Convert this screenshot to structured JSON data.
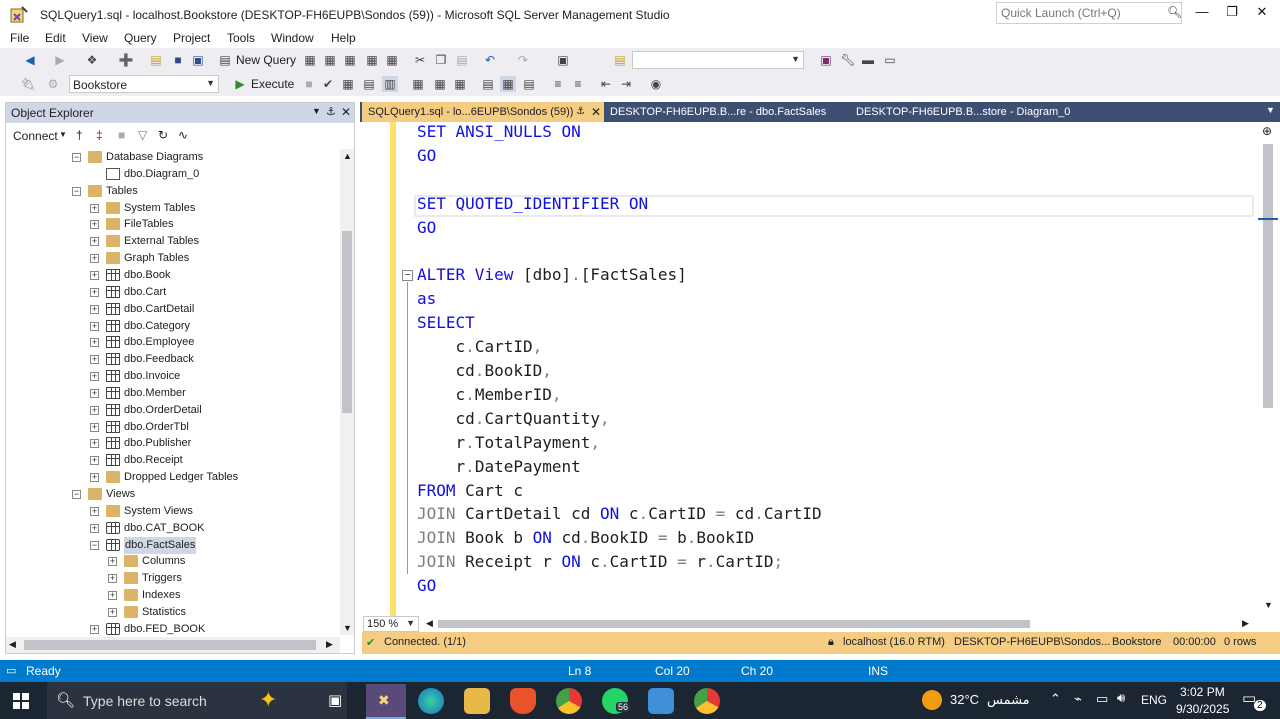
{
  "window": {
    "title": "SQLQuery1.sql - localhost.Bookstore (DESKTOP-FH6EUPB\\Sondos (59)) - Microsoft SQL Server Management Studio",
    "quick_launch_placeholder": "Quick Launch (Ctrl+Q)"
  },
  "menu": [
    "File",
    "Edit",
    "View",
    "Query",
    "Project",
    "Tools",
    "Window",
    "Help"
  ],
  "toolbar": {
    "new_query": "New Query",
    "database": "Bookstore",
    "execute": "Execute"
  },
  "object_explorer": {
    "title": "Object Explorer",
    "connect": "Connect",
    "tree": [
      {
        "label": "Database Diagrams",
        "level": 0,
        "icon": "folder",
        "expander": "minus"
      },
      {
        "label": "dbo.Diagram_0",
        "level": 1,
        "icon": "diagram",
        "expander": "none"
      },
      {
        "label": "Tables",
        "level": 0,
        "icon": "folder",
        "expander": "minus"
      },
      {
        "label": "System Tables",
        "level": 1,
        "icon": "folder",
        "expander": "plus"
      },
      {
        "label": "FileTables",
        "level": 1,
        "icon": "folder",
        "expander": "plus"
      },
      {
        "label": "External Tables",
        "level": 1,
        "icon": "folder",
        "expander": "plus"
      },
      {
        "label": "Graph Tables",
        "level": 1,
        "icon": "folder",
        "expander": "plus"
      },
      {
        "label": "dbo.Book",
        "level": 1,
        "icon": "table",
        "expander": "plus"
      },
      {
        "label": "dbo.Cart",
        "level": 1,
        "icon": "table",
        "expander": "plus"
      },
      {
        "label": "dbo.CartDetail",
        "level": 1,
        "icon": "table",
        "expander": "plus"
      },
      {
        "label": "dbo.Category",
        "level": 1,
        "icon": "table",
        "expander": "plus"
      },
      {
        "label": "dbo.Employee",
        "level": 1,
        "icon": "table",
        "expander": "plus"
      },
      {
        "label": "dbo.Feedback",
        "level": 1,
        "icon": "table",
        "expander": "plus"
      },
      {
        "label": "dbo.Invoice",
        "level": 1,
        "icon": "table",
        "expander": "plus"
      },
      {
        "label": "dbo.Member",
        "level": 1,
        "icon": "table",
        "expander": "plus"
      },
      {
        "label": "dbo.OrderDetail",
        "level": 1,
        "icon": "table",
        "expander": "plus"
      },
      {
        "label": "dbo.OrderTbl",
        "level": 1,
        "icon": "table",
        "expander": "plus"
      },
      {
        "label": "dbo.Publisher",
        "level": 1,
        "icon": "table",
        "expander": "plus"
      },
      {
        "label": "dbo.Receipt",
        "level": 1,
        "icon": "table",
        "expander": "plus"
      },
      {
        "label": "Dropped Ledger Tables",
        "level": 1,
        "icon": "folder",
        "expander": "plus"
      },
      {
        "label": "Views",
        "level": 0,
        "icon": "folder",
        "expander": "minus"
      },
      {
        "label": "System Views",
        "level": 1,
        "icon": "folder",
        "expander": "plus"
      },
      {
        "label": "dbo.CAT_BOOK",
        "level": 1,
        "icon": "view",
        "expander": "plus"
      },
      {
        "label": "dbo.FactSales",
        "level": 1,
        "icon": "view",
        "expander": "minus",
        "selected": true
      },
      {
        "label": "Columns",
        "level": 2,
        "icon": "folder",
        "expander": "plus"
      },
      {
        "label": "Triggers",
        "level": 2,
        "icon": "folder",
        "expander": "plus"
      },
      {
        "label": "Indexes",
        "level": 2,
        "icon": "folder",
        "expander": "plus"
      },
      {
        "label": "Statistics",
        "level": 2,
        "icon": "folder",
        "expander": "plus"
      },
      {
        "label": "dbo.FED_BOOK",
        "level": 1,
        "icon": "view",
        "expander": "plus"
      }
    ]
  },
  "tabs": [
    {
      "label": "SQLQuery1.sql - lo...6EUPB\\Sondos (59))",
      "active": true
    },
    {
      "label": "DESKTOP-FH6EUPB.B...re - dbo.FactSales",
      "active": false
    },
    {
      "label": "DESKTOP-FH6EUPB.B...store - Diagram_0",
      "active": false
    }
  ],
  "code_lines": [
    [
      {
        "t": "SET ANSI_NULLS ON",
        "c": "kw"
      }
    ],
    [
      {
        "t": "GO",
        "c": "kw"
      }
    ],
    [],
    [
      {
        "t": "SET QUOTED_IDENTIFIER ON",
        "c": "kw"
      }
    ],
    [
      {
        "t": "GO",
        "c": "kw"
      }
    ],
    [],
    [
      {
        "t": "ALTER View",
        "c": "kw"
      },
      {
        "t": " [dbo]",
        "c": ""
      },
      {
        "t": ".",
        "c": "gr"
      },
      {
        "t": "[FactSales]",
        "c": ""
      }
    ],
    [
      {
        "t": "as",
        "c": "kw"
      }
    ],
    [
      {
        "t": "SELECT",
        "c": "kw"
      }
    ],
    [
      {
        "t": "    c",
        "c": ""
      },
      {
        "t": ".",
        "c": "gr"
      },
      {
        "t": "CartID",
        "c": ""
      },
      {
        "t": ",",
        "c": "gr"
      }
    ],
    [
      {
        "t": "    cd",
        "c": ""
      },
      {
        "t": ".",
        "c": "gr"
      },
      {
        "t": "BookID",
        "c": ""
      },
      {
        "t": ",",
        "c": "gr"
      }
    ],
    [
      {
        "t": "    c",
        "c": ""
      },
      {
        "t": ".",
        "c": "gr"
      },
      {
        "t": "MemberID",
        "c": ""
      },
      {
        "t": ",",
        "c": "gr"
      }
    ],
    [
      {
        "t": "    cd",
        "c": ""
      },
      {
        "t": ".",
        "c": "gr"
      },
      {
        "t": "CartQuantity",
        "c": ""
      },
      {
        "t": ",",
        "c": "gr"
      }
    ],
    [
      {
        "t": "    r",
        "c": ""
      },
      {
        "t": ".",
        "c": "gr"
      },
      {
        "t": "TotalPayment",
        "c": ""
      },
      {
        "t": ",",
        "c": "gr"
      }
    ],
    [
      {
        "t": "    r",
        "c": ""
      },
      {
        "t": ".",
        "c": "gr"
      },
      {
        "t": "DatePayment",
        "c": ""
      }
    ],
    [
      {
        "t": "FROM",
        "c": "kw"
      },
      {
        "t": " Cart c",
        "c": ""
      }
    ],
    [
      {
        "t": "JOIN",
        "c": "gr"
      },
      {
        "t": " CartDetail cd ",
        "c": ""
      },
      {
        "t": "ON",
        "c": "kw"
      },
      {
        "t": " c",
        "c": ""
      },
      {
        "t": ".",
        "c": "gr"
      },
      {
        "t": "CartID ",
        "c": ""
      },
      {
        "t": "=",
        "c": "gr"
      },
      {
        "t": " cd",
        "c": ""
      },
      {
        "t": ".",
        "c": "gr"
      },
      {
        "t": "CartID",
        "c": ""
      }
    ],
    [
      {
        "t": "JOIN",
        "c": "gr"
      },
      {
        "t": " Book b ",
        "c": ""
      },
      {
        "t": "ON",
        "c": "kw"
      },
      {
        "t": " cd",
        "c": ""
      },
      {
        "t": ".",
        "c": "gr"
      },
      {
        "t": "BookID ",
        "c": ""
      },
      {
        "t": "=",
        "c": "gr"
      },
      {
        "t": " b",
        "c": ""
      },
      {
        "t": ".",
        "c": "gr"
      },
      {
        "t": "BookID",
        "c": ""
      }
    ],
    [
      {
        "t": "JOIN",
        "c": "gr"
      },
      {
        "t": " Receipt r ",
        "c": ""
      },
      {
        "t": "ON",
        "c": "kw"
      },
      {
        "t": " c",
        "c": ""
      },
      {
        "t": ".",
        "c": "gr"
      },
      {
        "t": "CartID ",
        "c": ""
      },
      {
        "t": "=",
        "c": "gr"
      },
      {
        "t": " r",
        "c": ""
      },
      {
        "t": ".",
        "c": "gr"
      },
      {
        "t": "CartID",
        "c": ""
      },
      {
        "t": ";",
        "c": "gr"
      }
    ],
    [
      {
        "t": "GO",
        "c": "kw"
      }
    ]
  ],
  "zoom": "150 %",
  "editor_status": {
    "connected": "Connected. (1/1)",
    "server": "localhost (16.0 RTM)",
    "user": "DESKTOP-FH6EUPB\\Sondos...",
    "database": "Bookstore",
    "time": "00:00:00",
    "rows": "0 rows"
  },
  "statusbar": {
    "ready": "Ready",
    "ln": "Ln 8",
    "col": "Col 20",
    "ch": "Ch 20",
    "ins": "INS"
  },
  "taskbar": {
    "search_placeholder": "Type here to search",
    "weather": "32°C",
    "weather_desc": "مشمس",
    "lang": "ENG",
    "time": "3:02 PM",
    "date": "9/30/2025",
    "badge": "56",
    "notifications": "2"
  },
  "colors": {
    "accent": "#007acc",
    "tab_active": "#f5cc84",
    "keyword": "#1010e0"
  }
}
